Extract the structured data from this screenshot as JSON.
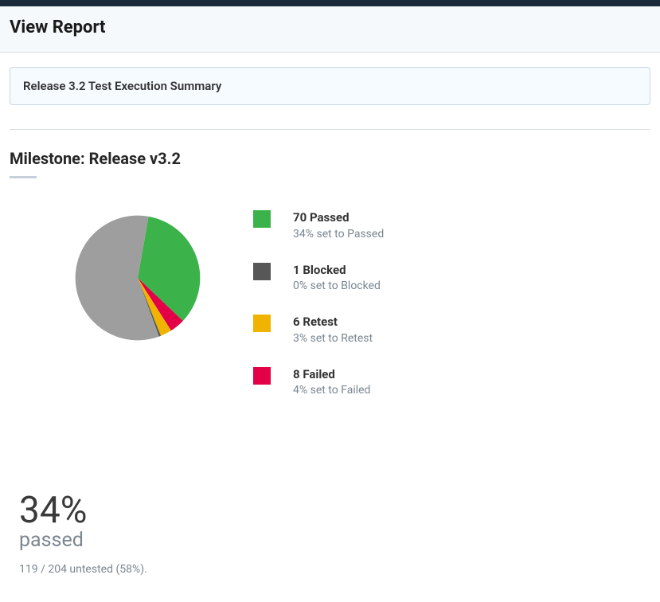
{
  "header": {
    "title": "View Report"
  },
  "report": {
    "name": "Release 3.2 Test Execution Summary"
  },
  "milestone": {
    "title": "Milestone: Release v3.2"
  },
  "chart_data": {
    "type": "pie",
    "title": "",
    "series": [
      {
        "name": "Passed",
        "value": 70,
        "percent": 34,
        "color": "#3cb24a"
      },
      {
        "name": "Blocked",
        "value": 1,
        "percent": 0,
        "color": "#575757"
      },
      {
        "name": "Retest",
        "value": 6,
        "percent": 3,
        "color": "#f0b400"
      },
      {
        "name": "Failed",
        "value": 8,
        "percent": 4,
        "color": "#e40046"
      },
      {
        "name": "Untested",
        "value": 119,
        "percent": 58,
        "color": "#9e9e9e"
      }
    ],
    "total": 204
  },
  "legend": {
    "items": [
      {
        "main": "70 Passed",
        "sub": "34% set to Passed",
        "color": "#3cb24a"
      },
      {
        "main": "1 Blocked",
        "sub": "0% set to Blocked",
        "color": "#575757"
      },
      {
        "main": "6 Retest",
        "sub": "3% set to Retest",
        "color": "#f0b400"
      },
      {
        "main": "8 Failed",
        "sub": "4% set to Failed",
        "color": "#e40046"
      }
    ]
  },
  "summary": {
    "percent": "34%",
    "label": "passed",
    "untested": "119 / 204 untested (58%)."
  },
  "colors": {
    "passed": "#3cb24a",
    "blocked": "#575757",
    "retest": "#f0b400",
    "failed": "#e40046",
    "untested": "#9e9e9e"
  }
}
